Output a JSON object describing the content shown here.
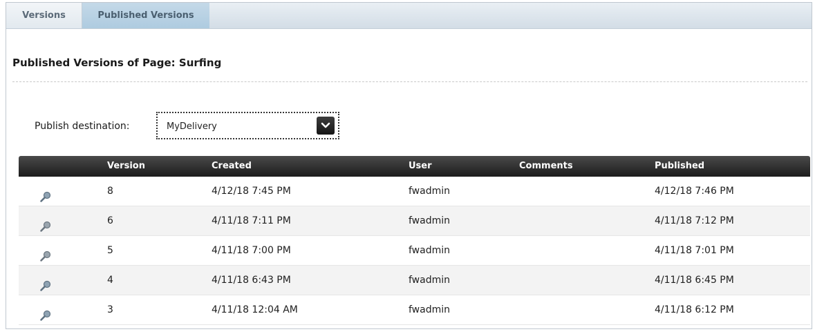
{
  "tabs": [
    {
      "label": "Versions",
      "active": false
    },
    {
      "label": "Published Versions",
      "active": true
    }
  ],
  "page_title": "Published Versions of Page: Surfing",
  "destination": {
    "label": "Publish destination:",
    "value": "MyDelivery"
  },
  "table": {
    "columns": [
      "",
      "Version",
      "Created",
      "User",
      "Comments",
      "Published"
    ],
    "rows": [
      {
        "icon": "magnifier-icon",
        "version": "8",
        "created": "4/12/18 7:45 PM",
        "user": "fwadmin",
        "comments": "",
        "published": "4/12/18 7:46 PM"
      },
      {
        "icon": "magnifier-icon",
        "version": "6",
        "created": "4/11/18 7:11 PM",
        "user": "fwadmin",
        "comments": "",
        "published": "4/11/18 7:12 PM"
      },
      {
        "icon": "magnifier-icon",
        "version": "5",
        "created": "4/11/18 7:00 PM",
        "user": "fwadmin",
        "comments": "",
        "published": "4/11/18 7:01 PM"
      },
      {
        "icon": "magnifier-icon",
        "version": "4",
        "created": "4/11/18 6:43 PM",
        "user": "fwadmin",
        "comments": "",
        "published": "4/11/18 6:45 PM"
      },
      {
        "icon": "magnifier-icon",
        "version": "3",
        "created": "4/11/18 12:04 AM",
        "user": "fwadmin",
        "comments": "",
        "published": "4/11/18 6:12 PM"
      }
    ]
  },
  "colors": {
    "header_bg": "#2a2a2a",
    "tab_active_bg": "#b9d2e4",
    "row_alt_bg": "#f3f3f3"
  }
}
